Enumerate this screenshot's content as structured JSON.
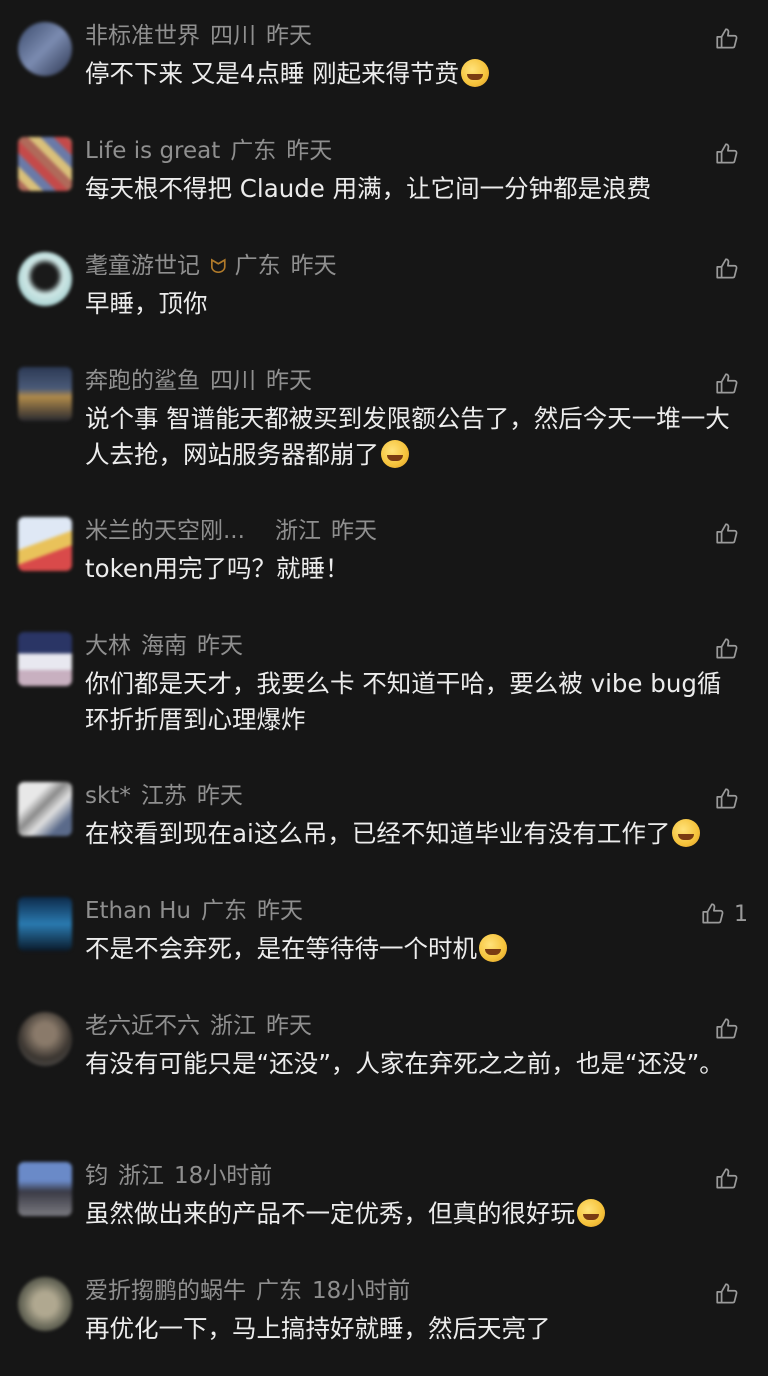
{
  "comments": [
    {
      "user": "非标准世界",
      "region": "四川",
      "time": "昨天",
      "text": "停不下来 又是4点睡 刚起来得节贲",
      "emoji": "crying-laugh",
      "likes": ""
    },
    {
      "user": "Life is great",
      "region": "广东",
      "time": "昨天",
      "text": "每天根不得把 Claude 用满，让它间一分钟都是浪费",
      "emoji": "",
      "likes": ""
    },
    {
      "user": "耄童游世记",
      "badge": "ᗢ",
      "region": "广东",
      "time": "昨天",
      "text": "早睡，顶你",
      "emoji": "",
      "likes": ""
    },
    {
      "user": "奔跑的鲨鱼",
      "region": "四川",
      "time": "昨天",
      "text": "说个事 智谱能天都被买到发限额公告了，然后今天一堆一大人去抢，网站服务器都崩了",
      "emoji": "crying-laugh",
      "likes": ""
    },
    {
      "user": "米兰的天空刚...",
      "region": "浙江",
      "time": "昨天",
      "text": "token用完了吗？就睡！",
      "emoji": "",
      "likes": ""
    },
    {
      "user": "大林",
      "region": "海南",
      "time": "昨天",
      "text": "你们都是天才，我要么卡 不知道干哈，要么被 vibe bug循环折折厝到心理爆炸",
      "emoji": "",
      "likes": ""
    },
    {
      "user": "skt*",
      "region": "江苏",
      "time": "昨天",
      "text": "在校看到现在ai这么吊，已经不知道毕业有没有工作了",
      "emoji": "shocked",
      "likes": ""
    },
    {
      "user": "Ethan Hu",
      "region": "广东",
      "time": "昨天",
      "text": "不是不会弃死，是在等待待一个时机",
      "emoji": "crying-laugh",
      "likes": "1"
    },
    {
      "user": "老六近不六",
      "region": "浙江",
      "time": "昨天",
      "text": "有没有可能只是“还没”，人家在弃死之之前，也是“还没”。",
      "emoji": "",
      "likes": ""
    },
    {
      "user": "钧",
      "region": "浙江",
      "time": "18小时前",
      "text": "虽然做出来的产品不一定优秀，但真的很好玩",
      "emoji": "grin",
      "likes": ""
    },
    {
      "user": "爱折搊鹏的蜗牛",
      "region": "广东",
      "time": "18小时前",
      "text": "再优化一下，马上搞持好就睡，然后天亮了",
      "emoji": "",
      "likes": ""
    }
  ]
}
